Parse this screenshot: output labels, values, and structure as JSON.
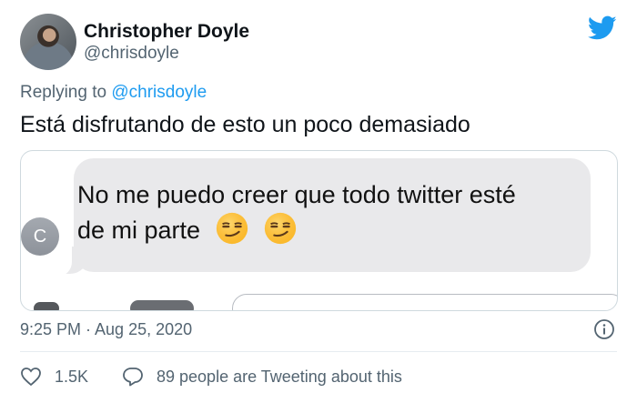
{
  "author": {
    "name": "Christopher Doyle",
    "handle": "@chrisdoyle",
    "avatar_icon": "profile-photo",
    "logo_icon": "twitter-bird-icon",
    "brand_color": "#1d9bf0"
  },
  "reply_context": {
    "prefix": "Replying to ",
    "handle": "@chrisdoyle"
  },
  "tweet_text": "Está disfrutando de esto un poco demasiado",
  "media": {
    "message_line_1": "No me puedo creer que todo twitter esté",
    "message_line_2": "de mi parte",
    "emojis": [
      "smirking-face",
      "smirking-face"
    ],
    "contact_initial": "C"
  },
  "meta": {
    "timestamp": "9:25 PM · Aug 25, 2020",
    "info_icon": "info-icon"
  },
  "engagement": {
    "likes": "1.5K",
    "replies_text": "89 people are Tweeting about this",
    "like_icon": "heart-icon",
    "reply_icon": "speech-bubble-icon"
  }
}
